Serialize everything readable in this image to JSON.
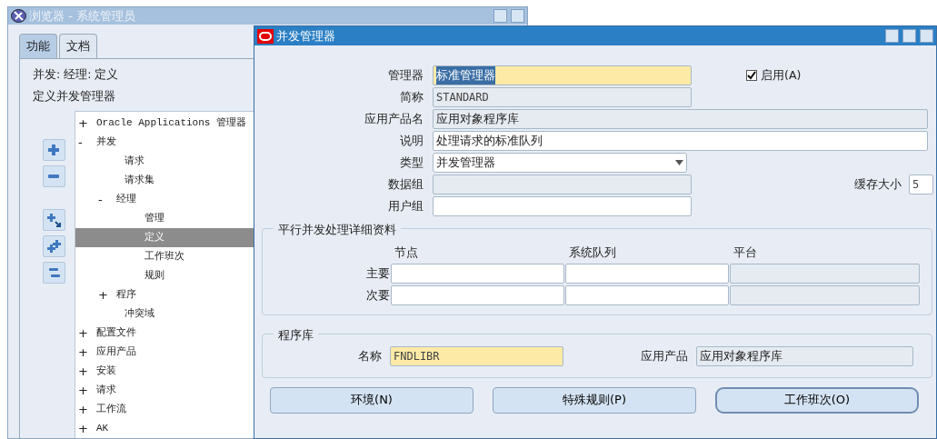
{
  "browser_window": {
    "title": "浏览器 - 系统管理员",
    "tabs": [
      {
        "label": "功能",
        "selected": true
      },
      {
        "label": "文档",
        "selected": false
      }
    ],
    "breadcrumb": "并发: 经理: 定义",
    "heading": "定义并发管理器",
    "tree": [
      {
        "toggle": "+",
        "label": "Oracle Applications 管理器",
        "selected": false
      },
      {
        "toggle": "-",
        "label": "并发",
        "selected": false,
        "children": [
          {
            "label": "请求",
            "selected": false
          },
          {
            "label": "请求集",
            "selected": false
          },
          {
            "toggle": "-",
            "label": "经理",
            "selected": false,
            "children": [
              {
                "label": "管理",
                "selected": false
              },
              {
                "label": "定义",
                "selected": true
              },
              {
                "label": "工作班次",
                "selected": false
              },
              {
                "label": "规则",
                "selected": false
              }
            ]
          },
          {
            "toggle": "+",
            "label": "程序",
            "selected": false
          },
          {
            "label": "冲突域",
            "selected": false
          }
        ]
      },
      {
        "toggle": "+",
        "label": "配置文件",
        "selected": false
      },
      {
        "toggle": "+",
        "label": "应用产品",
        "selected": false
      },
      {
        "toggle": "+",
        "label": "安装",
        "selected": false
      },
      {
        "toggle": "+",
        "label": "请求",
        "selected": false
      },
      {
        "toggle": "+",
        "label": "工作流",
        "selected": false
      },
      {
        "toggle": "+",
        "label": "AK",
        "selected": false
      }
    ]
  },
  "dialog": {
    "title": "并发管理器",
    "fields": [
      {
        "label": "管理器",
        "value": "标准管理器",
        "kind": "required",
        "text_selected": true
      },
      {
        "label": "简称",
        "value": "STANDARD",
        "kind": "readonly"
      },
      {
        "label": "应用产品名",
        "value": "应用对象程序库",
        "kind": "readonly"
      },
      {
        "label": "说明",
        "value": "处理请求的标准队列",
        "kind": "text"
      },
      {
        "label": "类型",
        "value": "并发管理器",
        "kind": "select"
      },
      {
        "label": "数据组",
        "kind": "readonly"
      },
      {
        "label": "用户组",
        "kind": "text"
      }
    ],
    "enabled": {
      "label": "启用(A)",
      "checked": true
    },
    "cache_size": {
      "label": "缓存大小",
      "value": "5"
    },
    "parallel": {
      "title": "平行并发处理详细资料",
      "columns": [
        {
          "label": "节点",
          "disabled": false
        },
        {
          "label": "系统队列",
          "disabled": false
        },
        {
          "label": "平台",
          "disabled": true
        }
      ],
      "rows": [
        {
          "label": "主要"
        },
        {
          "label": "次要"
        }
      ]
    },
    "library": {
      "title": "程序库",
      "fields": [
        {
          "label": "名称",
          "value": "FNDLIBR",
          "kind": "required"
        },
        {
          "label": "应用产品",
          "value": "应用对象程序库",
          "kind": "readonly"
        }
      ]
    },
    "buttons": [
      {
        "label": "环境(N)",
        "default": false
      },
      {
        "label": "特殊规则(P)",
        "default": false
      },
      {
        "label": "工作班次(O)",
        "default": true
      }
    ]
  }
}
